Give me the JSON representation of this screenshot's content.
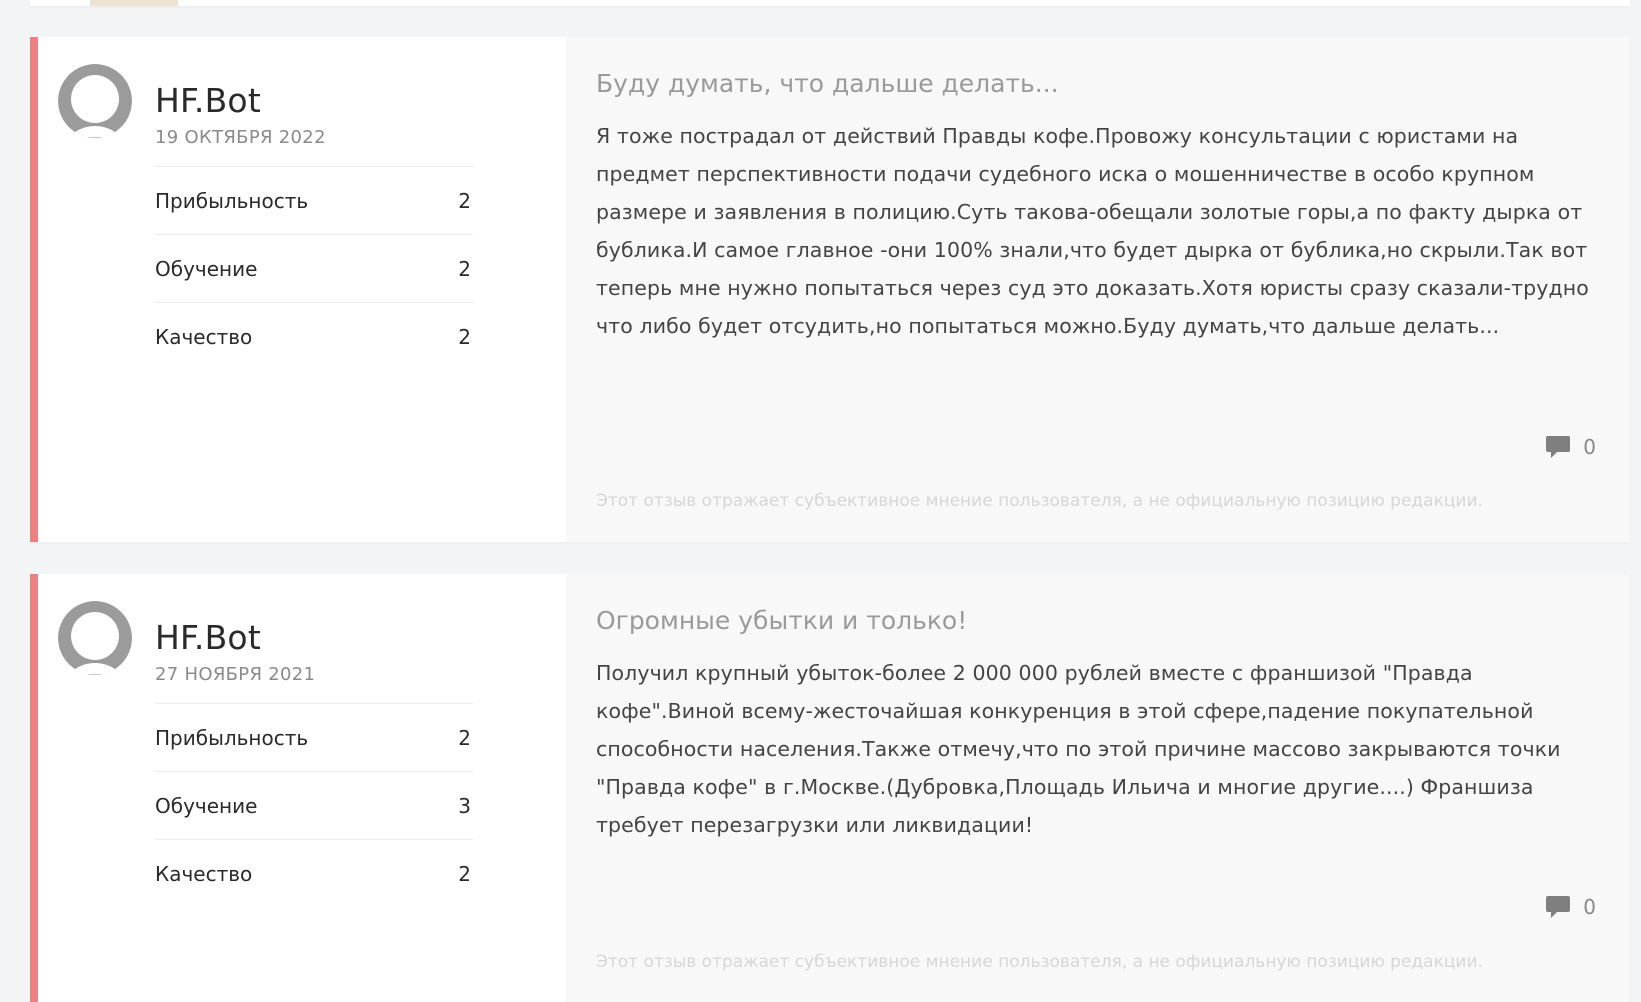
{
  "reviews": [
    {
      "author": "HF.Bot",
      "date": "19 ОКТЯБРЯ 2022",
      "ratings": [
        {
          "label": "Прибыльность",
          "value": "2"
        },
        {
          "label": "Обучение",
          "value": "2"
        },
        {
          "label": "Качество",
          "value": "2"
        }
      ],
      "title": "Буду думать, что дальше делать...",
      "text": "Я тоже пострадал от действий Правды кофе.Провожу консультации с юристами на предмет перспективности подачи судебного иска о мошенничестве в особо крупном размере и заявления в полицию.Суть такова-обещали золотые горы,а по факту дырка от бублика.И самое главное -они 100% знали,что будет дырка от бублика,но скрыли.Так вот теперь мне нужно попытаться через суд это доказать.Хотя юристы сразу сказали-трудно что либо будет отсудить,но попытаться можно.Буду думать,что дальше делать...",
      "comments": "0",
      "disclaimer": "Этот отзыв отражает субъективное мнение пользователя, а не официальную позицию редакции."
    },
    {
      "author": "HF.Bot",
      "date": "27 НОЯБРЯ 2021",
      "ratings": [
        {
          "label": "Прибыльность",
          "value": "2"
        },
        {
          "label": "Обучение",
          "value": "3"
        },
        {
          "label": "Качество",
          "value": "2"
        }
      ],
      "title": "Огромные убытки и только!",
      "text": "Получил крупный убыток-более 2 000 000 рублей вместе с франшизой \"Правда кофе\".Виной всему-жесточайшая конкуренция в этой сфере,падение покупательной способности населения.Также отмечу,что по этой причине массово закрываются точки \"Правда кофе\" в г.Москве.(Дубровка,Площадь Ильича и многие другие....) Франшиза требует перезагрузки или ликвидации!",
      "comments": "0",
      "disclaimer": "Этот отзыв отражает субъективное мнение пользователя, а не официальную позицию редакции."
    }
  ],
  "colors": {
    "accent": "#f08080",
    "avatar": "#9b9b9b",
    "title": "#9a9a9a",
    "text": "#444444"
  },
  "icons": {
    "avatar": "user-avatar-icon",
    "comments": "comment-bubble-icon"
  }
}
